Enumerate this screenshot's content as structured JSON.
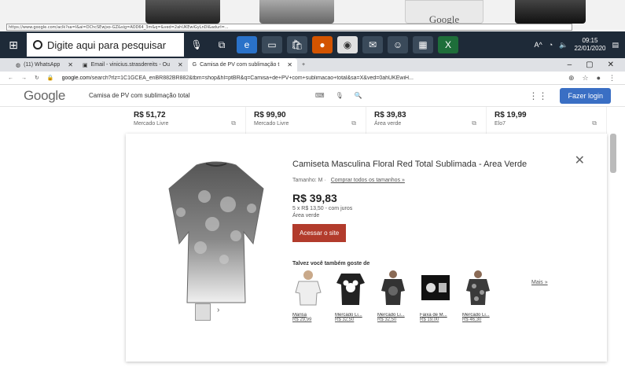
{
  "topstrip": {
    "thumb_text": "Google",
    "url": "https://www.google.com/aclk?sa=l&ai=DChcSEwjxo-GZ&sig=AOD64_3m&q=&ved=2ahUKEwiGyLnDl&adurl=..."
  },
  "taskbar": {
    "search_placeholder": "Digite aqui para pesquisar",
    "time": "09:15",
    "date": "22/01/2020",
    "tray_text": "A^"
  },
  "browser": {
    "tabs": [
      {
        "label": "(11) WhatsApp"
      },
      {
        "label": "Email - vinicius.strasdereits - Ou"
      },
      {
        "label": "Camisa de PV com sublimação t"
      }
    ],
    "url_prefix": "google.com",
    "url_rest": "/search?rlz=1C1GCEA_enBR882BR882&tbm=shop&hl=ptBR&q=Camisa+de+PV+com+sublimacao+total&sa=X&ved=0ahUKEwiH..."
  },
  "google": {
    "logo": "Google",
    "query": "Camisa de PV com sublimação total",
    "login_label": "Fazer login"
  },
  "price_strip": [
    {
      "price": "R$ 51,72",
      "store": "Mercado Livre"
    },
    {
      "price": "R$ 99,90",
      "store": "Mercado Livre"
    },
    {
      "price": "R$ 39,83",
      "store": "Área verde"
    },
    {
      "price": "R$ 19,99",
      "store": "Elo7"
    }
  ],
  "product": {
    "title": "Camiseta Masculina Floral Red Total Sublimada - Area Verde",
    "size_label": "Tamanho: M ·",
    "compare_link": "Comprar todos os tamanhos »",
    "price": "R$ 39,83",
    "installments": "5 x R$ 13,50 - com juros",
    "seller": "Área verde",
    "visit_label": "Acessar o site",
    "also_like": "Talvez você também goste de",
    "more_label": "Mais »",
    "recommendations": [
      {
        "name": "Marisa",
        "price": "R$ 29,99"
      },
      {
        "name": "Mercado Li...",
        "price": "R$ 32,50"
      },
      {
        "name": "Mercado Li...",
        "price": "R$ 32,50"
      },
      {
        "name": "Faixa de M...",
        "price": "R$ 19,00"
      },
      {
        "name": "Mercado Li...",
        "price": "R$ 46,30"
      }
    ]
  }
}
